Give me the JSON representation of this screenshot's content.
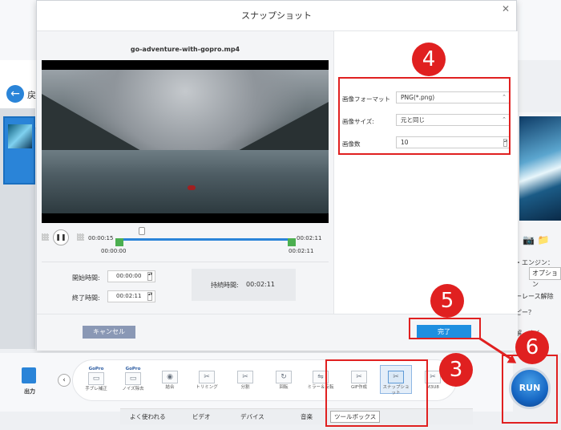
{
  "background": {
    "back_text": "戻",
    "right_text_1": "・エンジン：",
    "right_text_2": "オプション",
    "right_text_3": "ーレース解除",
    "right_text_4": "ピー？",
    "right_btn": "解　まく"
  },
  "dialog": {
    "title": "スナップショット",
    "close": "✕",
    "filename": "go-adventure-with-gopro.mp4",
    "player": {
      "current_time": "00:00:15",
      "end_time": "00:02:11",
      "range_start": "00:00:00",
      "range_end": "00:02:11"
    },
    "trim": {
      "start_label": "開始時間:",
      "start_value": "00:00:00",
      "end_label": "終了時間:",
      "end_value": "00:02:11",
      "duration_label": "持続時間:",
      "duration_value": "00:02:11"
    },
    "settings": {
      "format_label": "画像フォーマット",
      "format_value": "PNG(*.png)",
      "size_label": "画像サイズ:",
      "size_value": "元と同じ",
      "count_label": "画像数",
      "count_value": "10"
    },
    "cancel_label": "キャンセル",
    "ok_label": "完了"
  },
  "toolbar": {
    "output_label": "出力",
    "tools": [
      {
        "label": "手ブレ補正",
        "brand": "GoPro"
      },
      {
        "label": "ノイズ除去",
        "brand": "GoPro"
      },
      {
        "label": "結合"
      },
      {
        "label": "トリミング"
      },
      {
        "label": "分割"
      },
      {
        "label": "回転"
      },
      {
        "label": "ミラー＆反転"
      },
      {
        "label": "GIF作成"
      },
      {
        "label": "スナップショット"
      },
      {
        "label": "M3U8"
      }
    ],
    "tabs": [
      "よく使われる",
      "ビデオ",
      "デバイス",
      "音楽",
      "ツールボックス"
    ],
    "run_label": "RUN"
  },
  "annotations": {
    "n3": "3",
    "n4": "4",
    "n5": "5",
    "n6": "6"
  },
  "colors": {
    "accent": "#1e8fe0",
    "annotation": "#e02020",
    "trim_marker": "#4caf50"
  }
}
